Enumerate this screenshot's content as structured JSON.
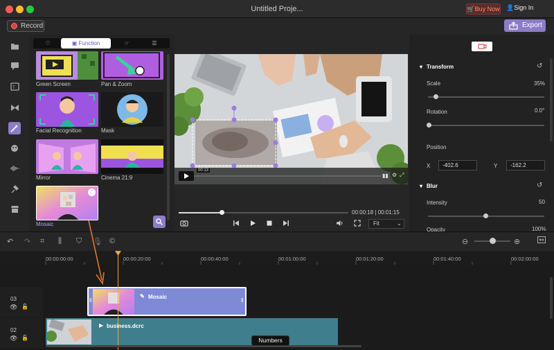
{
  "window": {
    "title": "Untitled Proje...",
    "buy_now": "Buy Now",
    "sign_in": "Sign In"
  },
  "toolbar": {
    "record_label": "Record",
    "export_label": "Export"
  },
  "sidebar": {
    "icons": [
      "folder-icon",
      "text-icon",
      "caption-icon",
      "transition-icon",
      "effects-icon",
      "sticker-icon",
      "audio-icon",
      "pin-icon",
      "store-icon"
    ]
  },
  "library": {
    "tabs": [
      {
        "label": "",
        "icon": "heart-icon"
      },
      {
        "label": "Function",
        "icon": "function-icon"
      },
      {
        "label": "",
        "icon": "gesture-icon"
      },
      {
        "label": "",
        "icon": "list-icon"
      }
    ],
    "items": [
      {
        "label": "Green Screen"
      },
      {
        "label": "Pan & Zoom"
      },
      {
        "label": "Facial Recognition"
      },
      {
        "label": "Mask"
      },
      {
        "label": "Mirror"
      },
      {
        "label": "Cinema 21:9"
      },
      {
        "label": "Mosaic"
      }
    ]
  },
  "preview": {
    "overlay_time": "00:13",
    "current_time": "00:00:18",
    "total_time": "00:01:15",
    "time_sep": "|",
    "zoom_mode": "Fit",
    "progress": 0.255
  },
  "properties": {
    "transform_title": "Transform",
    "scale_label": "Scale",
    "scale_value": "35%",
    "scale_level": 0.35,
    "rotation_label": "Rotation",
    "rotation_value": "0.0°",
    "position_label": "Position",
    "x_label": "X",
    "x_value": "-402.6",
    "y_label": "Y",
    "y_value": "-162.2",
    "blur_title": "Blur",
    "intensity_label": "Intensity",
    "intensity_value": "50",
    "opacity_label": "Opacity",
    "opacity_value": "100%"
  },
  "timeline": {
    "ruler": [
      "00:00:00:00",
      "00:00:20:00",
      "00:00:40:00",
      "00:01:00:00",
      "00:01:20:00",
      "00:01:40:00",
      "00:02:00:00"
    ],
    "tracks": [
      {
        "num": "03",
        "clip": "Mosaic"
      },
      {
        "num": "02",
        "clip": "business.dcrc"
      }
    ],
    "tooltip": "Numbers"
  },
  "colors": {
    "accent": "#8d7cc7",
    "playhead": "#f5a623",
    "mosaic_clip": "#7f8ad6",
    "video_clip": "#3f7e8d"
  }
}
